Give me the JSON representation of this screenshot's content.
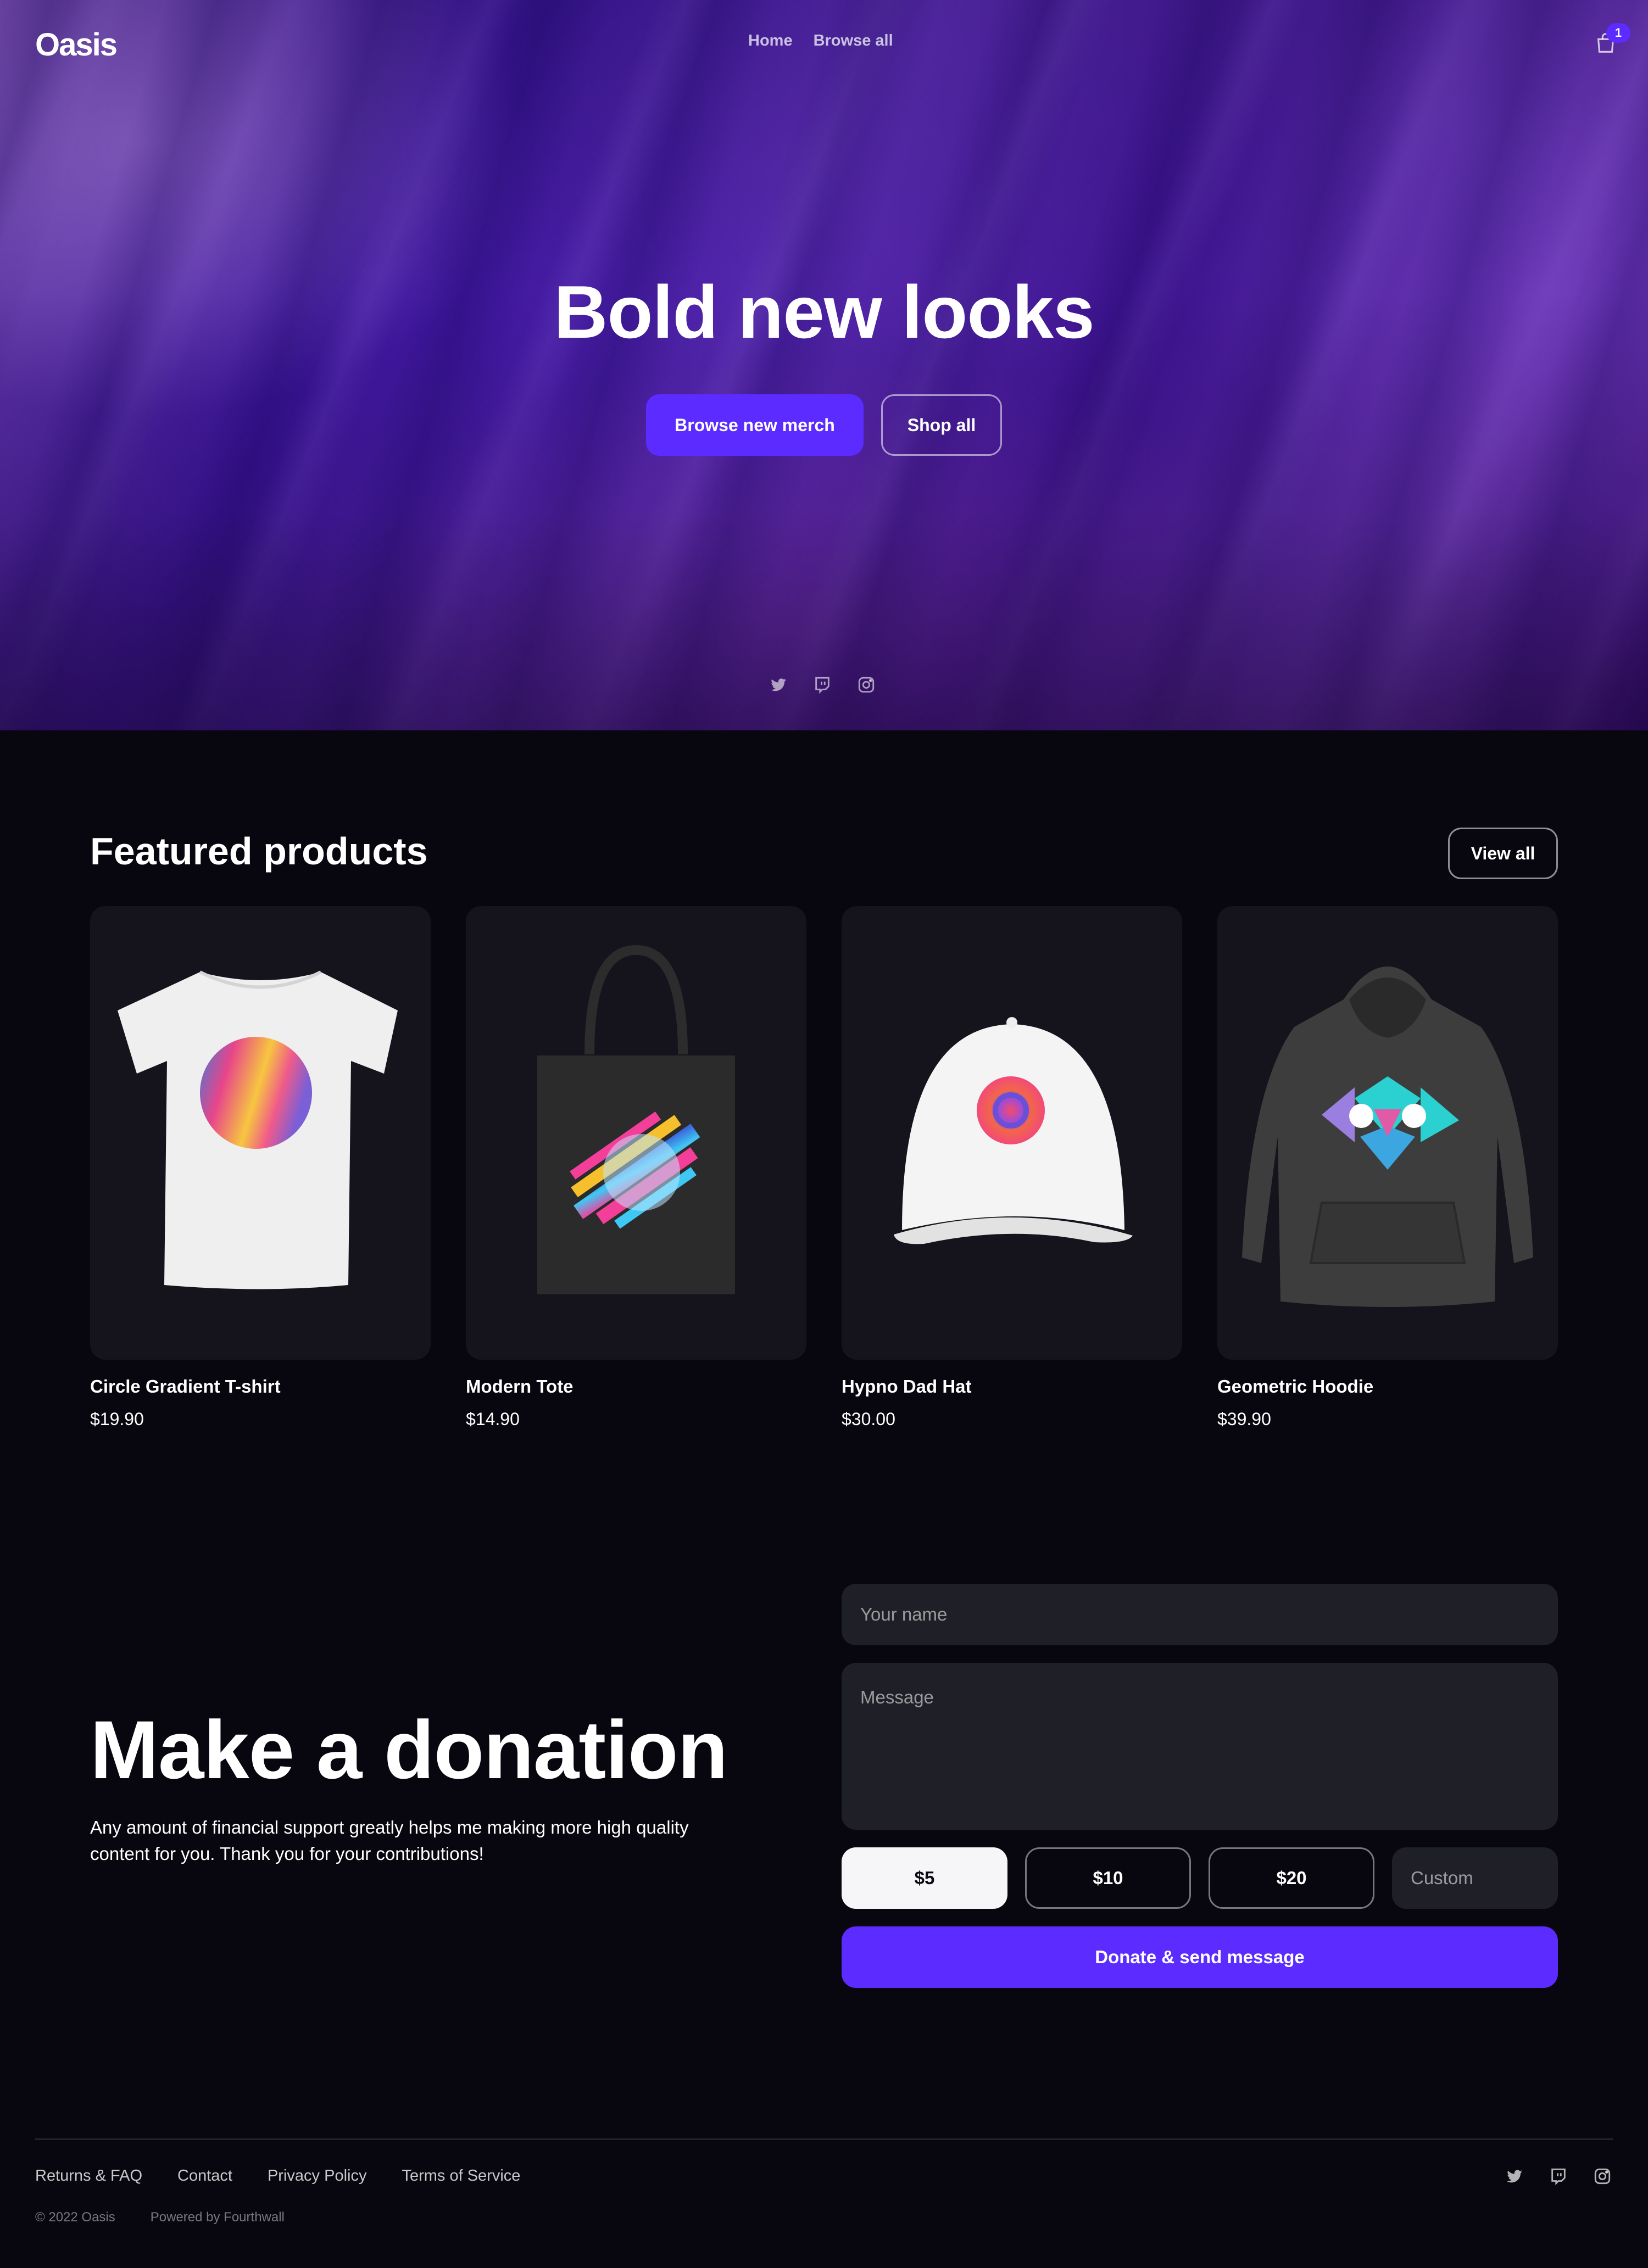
{
  "header": {
    "logo_text": "Oasis",
    "nav": [
      {
        "label": "Home"
      },
      {
        "label": "Browse all"
      }
    ],
    "cart_count": "1"
  },
  "hero": {
    "title": "Bold new looks",
    "primary_button": "Browse new merch",
    "secondary_button": "Shop all",
    "social_icons": [
      "twitter-icon",
      "twitch-icon",
      "instagram-icon"
    ]
  },
  "featured": {
    "title": "Featured products",
    "view_all_label": "View all",
    "products": [
      {
        "name": "Circle Gradient T-shirt",
        "price": "$19.90"
      },
      {
        "name": "Modern Tote",
        "price": "$14.90"
      },
      {
        "name": "Hypno Dad Hat",
        "price": "$30.00"
      },
      {
        "name": "Geometric Hoodie",
        "price": "$39.90"
      }
    ]
  },
  "donation": {
    "title": "Make a donation",
    "description": "Any amount of financial support greatly helps me making more high quality content for you. Thank you for your contributions!",
    "name_placeholder": "Your name",
    "message_placeholder": "Message",
    "amounts": [
      "$5",
      "$10",
      "$20"
    ],
    "selected_amount": "$5",
    "custom_placeholder": "Custom",
    "submit_label": "Donate & send message"
  },
  "footer": {
    "links": [
      "Returns & FAQ",
      "Contact",
      "Privacy Policy",
      "Terms of Service"
    ],
    "copyright": "© 2022 Oasis",
    "powered_by": "Powered by Fourthwall",
    "social_icons": [
      "twitter-icon",
      "twitch-icon",
      "instagram-icon"
    ]
  },
  "colors": {
    "accent": "#5b2bff",
    "page_background": "#08070f",
    "card_background": "#15141d",
    "field_background": "#1f1f27"
  }
}
